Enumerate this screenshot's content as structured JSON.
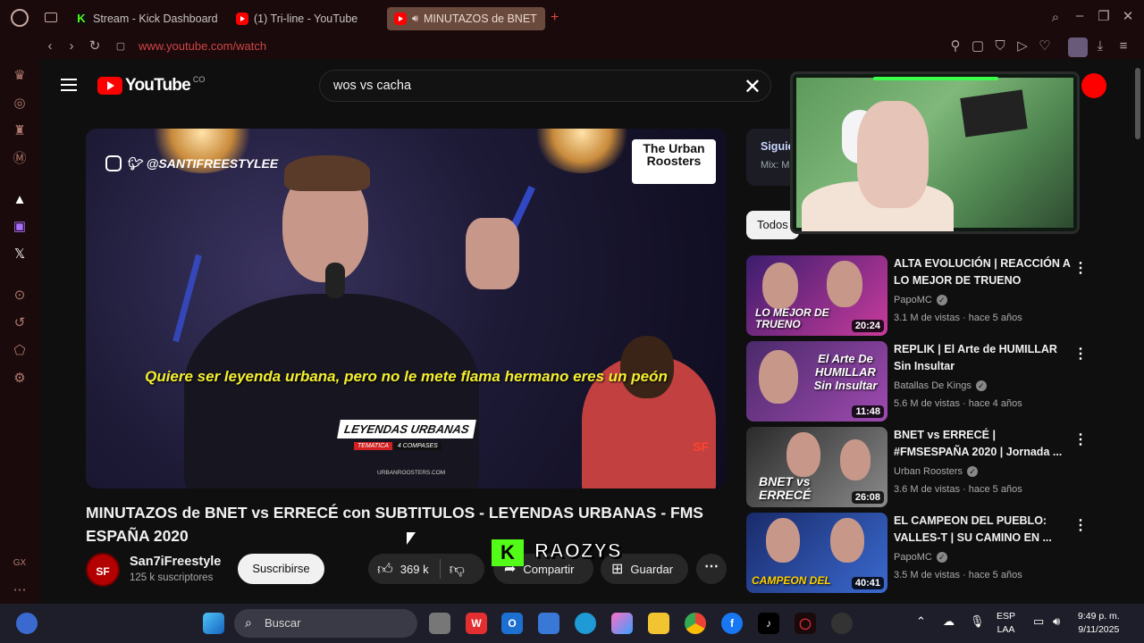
{
  "browser": {
    "tabs": [
      {
        "label": "Stream - Kick Dashboard",
        "icon": "kick-icon",
        "active": false
      },
      {
        "label": "(1) Tri-line - YouTube",
        "icon": "youtube-icon",
        "active": false
      },
      {
        "label": "MINUTAZOS de BNET",
        "icon": "youtube-icon",
        "active": true
      }
    ],
    "new_tab": "+",
    "url": "www.youtube.com/watch"
  },
  "youtube": {
    "logo_text": "YouTube",
    "country_code": "CO",
    "search_query": "wos vs cacha",
    "video": {
      "handle": "@SANTIFREESTYLEE",
      "brand_line1": "The Urban",
      "brand_line2": "Roosters",
      "subtitle": "Quiere ser leyenda urbana, pero no le mete flama hermano eres un peón",
      "lower_third": "LEYENDAS URBANAS",
      "lower_third_sub1": "TEMATICA",
      "lower_third_sub2": "4 COMPASES",
      "lower_third_url": "URBANROOSTERS.COM",
      "corner_mark": "SF"
    },
    "title": "MINUTAZOS de BNET vs ERRECÉ con SUBTITULOS - LEYENDAS URBANAS - FMS ESPAÑA 2020",
    "channel": {
      "name": "San7iFreestyle",
      "subs": "125 k suscriptores",
      "avatar_text": "SF"
    },
    "subscribe": "Suscribirse",
    "likes": "369 k",
    "share": "Compartir",
    "save": "Guardar",
    "up_next": {
      "title": "Siguie",
      "sub": "Mix: M"
    },
    "chip": "Todos",
    "recommendations": [
      {
        "title": "ALTA EVOLUCIÓN | REACCIÓN A LO MEJOR DE TRUENO",
        "channel": "PapoMC",
        "meta": "3.1 M de vistas · hace 5 años",
        "duration": "20:24",
        "thumb_text": "LO MEJOR DE TRUENO",
        "colors": [
          "#3b1d6e",
          "#c93b9c"
        ]
      },
      {
        "title": "REPLIK | El Arte de HUMILLAR Sin Insultar",
        "channel": "Batallas De Kings",
        "meta": "5.6 M de vistas · hace 4 años",
        "duration": "11:48",
        "thumb_text": "El Arte De HUMILLAR Sin Insultar",
        "colors": [
          "#4a2a6a",
          "#a04ab0"
        ]
      },
      {
        "title": "BNET vs ERRECÉ | #FMSESPAÑA 2020 | Jornada ...",
        "channel": "Urban Roosters",
        "meta": "3.6 M de vistas · hace 5 años",
        "duration": "26:08",
        "thumb_text": "BNET vs ERRECÉ",
        "colors": [
          "#2a2a2a",
          "#8a8a8a"
        ]
      },
      {
        "title": "EL CAMPEON DEL PUEBLO: VALLES-T | SU CAMINO EN ...",
        "channel": "PapoMC",
        "meta": "3.5 M de vistas · hace 5 años",
        "duration": "40:41",
        "thumb_text": "CAMPEON DEL",
        "colors": [
          "#1a2a6a",
          "#3a6ad0"
        ]
      }
    ]
  },
  "overlay": {
    "streamer": "RAOZYS",
    "kick_letter": "K"
  },
  "taskbar": {
    "search_label": "Buscar",
    "lang_line1": "ESP",
    "lang_line2": "LAA",
    "time": "9:49 p. m.",
    "date": "9/11/2025"
  },
  "colors": {
    "accent": "#ff0000",
    "kick": "#53fc18",
    "subtitle": "#f4ef30"
  }
}
